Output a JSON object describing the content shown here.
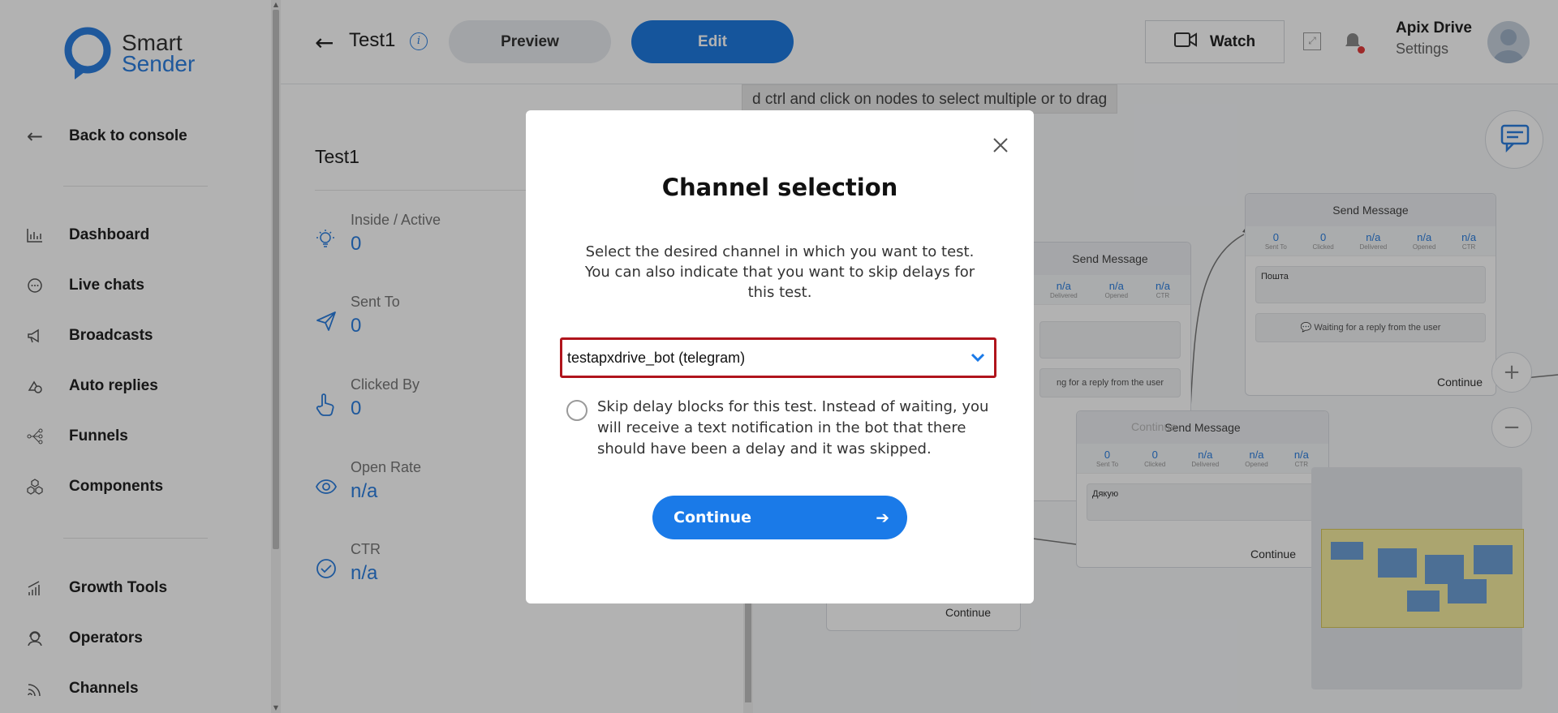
{
  "brand": {
    "line1": "Smart",
    "line2": "Sender"
  },
  "sidebar": {
    "back": "Back to console",
    "items": [
      {
        "label": "Dashboard",
        "icon": "bar-chart-icon"
      },
      {
        "label": "Live chats",
        "icon": "chat-bubble-icon"
      },
      {
        "label": "Broadcasts",
        "icon": "megaphone-icon"
      },
      {
        "label": "Auto replies",
        "icon": "auto-reply-icon"
      },
      {
        "label": "Funnels",
        "icon": "funnel-icon"
      },
      {
        "label": "Components",
        "icon": "components-icon"
      }
    ],
    "items2": [
      {
        "label": "Growth Tools",
        "icon": "growth-icon"
      },
      {
        "label": "Operators",
        "icon": "operator-icon"
      },
      {
        "label": "Channels",
        "icon": "channels-icon"
      }
    ]
  },
  "header": {
    "title": "Test1",
    "preview": "Preview",
    "edit": "Edit",
    "watch": "Watch",
    "user_name": "Apix Drive",
    "user_settings": "Settings"
  },
  "stats": {
    "title": "Test1",
    "items": [
      {
        "label": "Inside / Active",
        "value": "0",
        "icon": "lightbulb-icon"
      },
      {
        "label": "Sent To",
        "value": "0",
        "icon": "paper-plane-icon"
      },
      {
        "label": "Clicked By",
        "value": "0",
        "icon": "hand-pointer-icon"
      },
      {
        "label": "Open Rate",
        "value": "n/a",
        "icon": "eye-icon"
      },
      {
        "label": "CTR",
        "value": "n/a",
        "icon": "check-circle-icon"
      }
    ]
  },
  "canvas": {
    "hint": "d ctrl and click on nodes to select multiple or to drag",
    "nodes": [
      {
        "title": "Send Message",
        "metrics": [
          {
            "v": "0",
            "k": "Sent To"
          },
          {
            "v": "0",
            "k": "Clicked"
          },
          {
            "v": "n/a",
            "k": "Delivered"
          },
          {
            "v": "n/a",
            "k": "Opened"
          },
          {
            "v": "n/a",
            "k": "CTR"
          }
        ],
        "body": "Пошта",
        "waiting": "Waiting for a reply from the user",
        "continue": "Continue"
      },
      {
        "title": "Send Message",
        "metrics": [
          {
            "v": "n/a",
            "k": "Delivered"
          },
          {
            "v": "n/a",
            "k": "Opened"
          },
          {
            "v": "n/a",
            "k": "CTR"
          }
        ],
        "waiting": "ng for a reply from the user"
      },
      {
        "title": "Send Message",
        "metrics": [
          {
            "v": "0",
            "k": "Sent To"
          },
          {
            "v": "0",
            "k": "Clicked"
          },
          {
            "v": "n/a",
            "k": "Delivered"
          },
          {
            "v": "n/a",
            "k": "Opened"
          },
          {
            "v": "n/a",
            "k": "CTR"
          }
        ],
        "body": "Дякую",
        "continue": "Continue"
      }
    ],
    "ghost_continue": "Continue",
    "bottom_continue": "Continue"
  },
  "modal": {
    "title": "Channel selection",
    "description": "Select the desired channel in which you want to test. You can also indicate that you want to skip delays for this test.",
    "selected_channel": "testapxdrive_bot (telegram)",
    "skip_label": "Skip delay blocks for this test. Instead of waiting, you will receive a text notification in the bot that there should have been a delay and it was skipped.",
    "continue": "Continue"
  },
  "colors": {
    "accent": "#1a7ae8",
    "select_border": "#b0141c"
  }
}
